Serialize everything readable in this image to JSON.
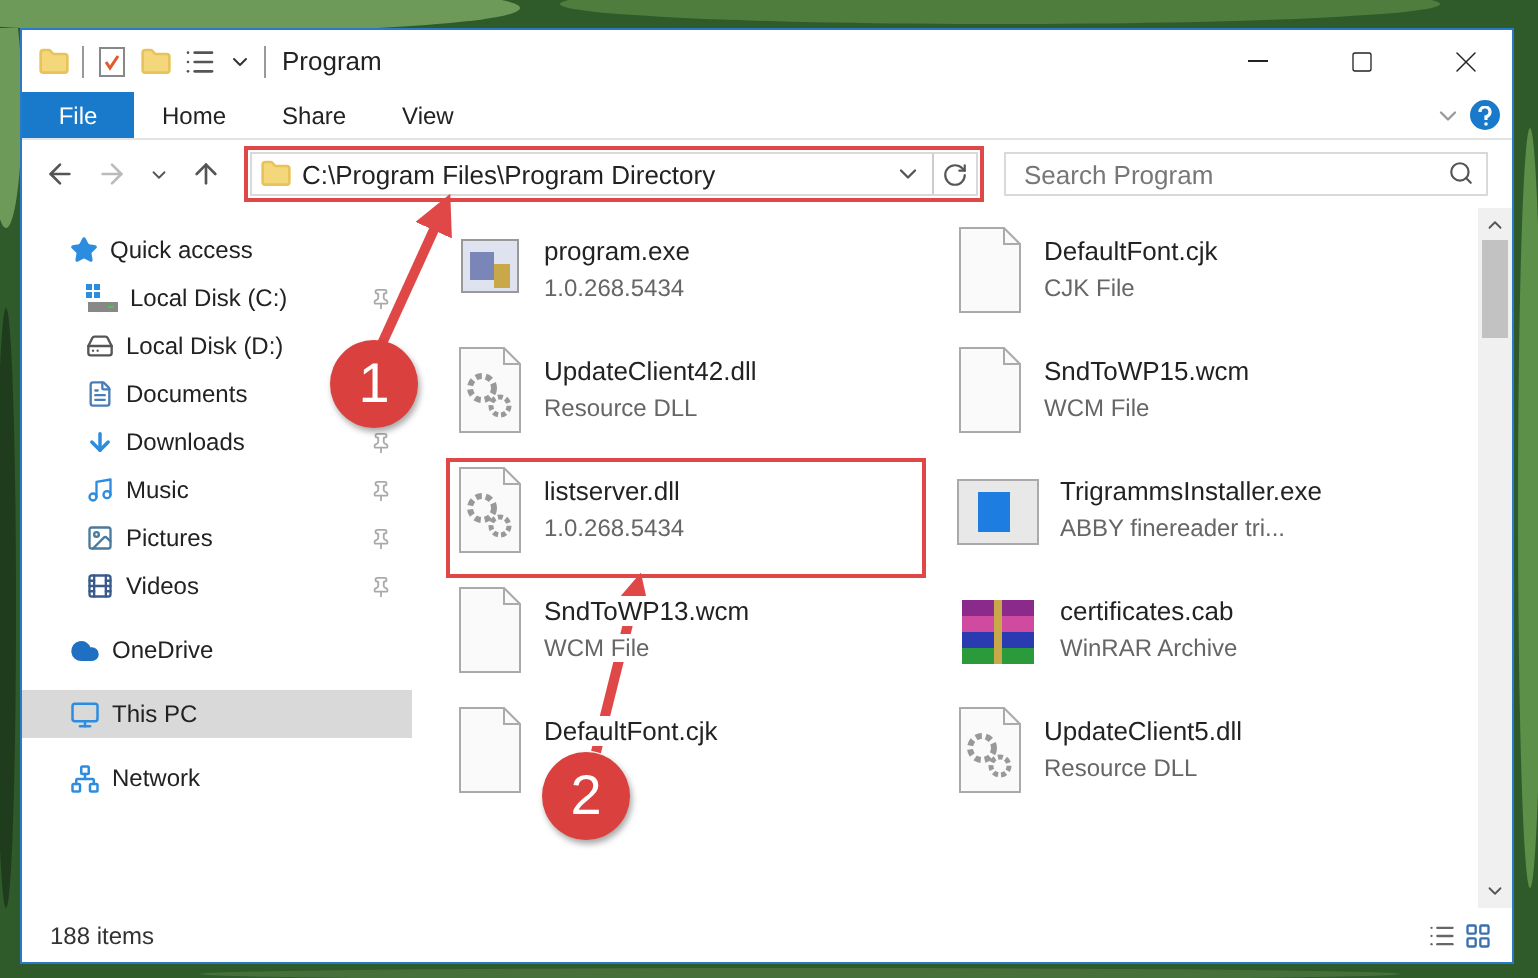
{
  "window": {
    "title": "Program"
  },
  "ribbon_tabs": [
    {
      "label": "File",
      "selected": true
    },
    {
      "label": "Home",
      "selected": false
    },
    {
      "label": "Share",
      "selected": false
    },
    {
      "label": "View",
      "selected": false
    }
  ],
  "address_bar": {
    "path": "C:\\Program Files\\Program Directory",
    "highlighted": true
  },
  "search": {
    "placeholder": "Search Program"
  },
  "sidebar": {
    "items": [
      {
        "label": "Quick access",
        "kind": "star",
        "selected": false,
        "children": [
          {
            "label": "Local Disk (C:)",
            "kind": "drive-c",
            "pinned": true,
            "selected": false
          },
          {
            "label": "Local Disk (D:)",
            "kind": "drive",
            "selected": false
          },
          {
            "label": "Documents",
            "kind": "documents",
            "selected": false
          },
          {
            "label": "Downloads",
            "kind": "downloads",
            "pinned": true,
            "selected": false
          },
          {
            "label": "Music",
            "kind": "music",
            "pinned": true,
            "selected": false
          },
          {
            "label": "Pictures",
            "kind": "pictures",
            "pinned": true,
            "selected": false
          },
          {
            "label": "Videos",
            "kind": "videos",
            "pinned": true,
            "selected": false
          }
        ]
      },
      {
        "label": "OneDrive",
        "kind": "cloud",
        "selected": false
      },
      {
        "label": "This PC",
        "kind": "pc",
        "selected": true
      },
      {
        "label": "Network",
        "kind": "network",
        "selected": false
      }
    ]
  },
  "files": [
    {
      "name": "program.exe",
      "detail": "1.0.268.5434",
      "kind": "exe",
      "highlighted": false
    },
    {
      "name": "DefaultFont.cjk",
      "detail": "CJK File",
      "kind": "blank",
      "highlighted": false
    },
    {
      "name": "UpdateClient42.dll",
      "detail": "Resource DLL",
      "kind": "dll",
      "highlighted": false
    },
    {
      "name": "SndToWP15.wcm",
      "detail": "WCM File",
      "kind": "blank",
      "highlighted": false
    },
    {
      "name": "listserver.dll",
      "detail": "1.0.268.5434",
      "kind": "dll",
      "highlighted": true
    },
    {
      "name": "TrigrammsInstaller.exe",
      "detail": "ABBY finereader tri...",
      "kind": "installer",
      "highlighted": false
    },
    {
      "name": "SndToWP13.wcm",
      "detail": "WCM File",
      "kind": "blank",
      "highlighted": false
    },
    {
      "name": "certificates.cab",
      "detail": "WinRAR Archive",
      "kind": "archive",
      "highlighted": false
    },
    {
      "name": "DefaultFont.cjk",
      "kind": "blank",
      "highlighted": false
    },
    {
      "name": "UpdateClient5.dll",
      "detail": "Resource DLL",
      "kind": "dll",
      "highlighted": false
    }
  ],
  "status_bar": {
    "item_count": "188 items"
  },
  "annotations": [
    {
      "label": "1"
    },
    {
      "label": "2"
    }
  ]
}
